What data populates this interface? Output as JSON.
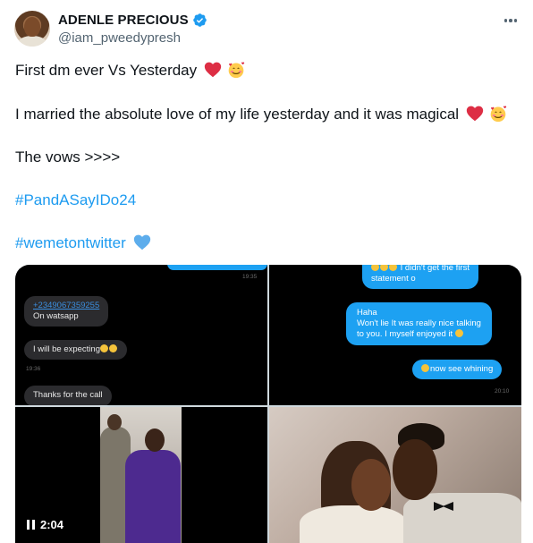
{
  "author": {
    "display_name": "ADENLE PRECIOUS",
    "handle": "@iam_pweedypresh",
    "verified": true
  },
  "tweet": {
    "line1": "First dm ever Vs Yesterday",
    "line2": "I married the absolute love of my life yesterday and it was magical",
    "line3": "The vows >>>>",
    "hashtag1": "#PandASayIDo24",
    "hashtag2": "#wemetontwitter"
  },
  "media": {
    "chat_left": {
      "top_time": "19:35",
      "phone": "+2349067359255",
      "on_watsapp": "On watsapp",
      "expecting": "I will be expecting",
      "mid_time": "19:36",
      "thanks": "Thanks for the call"
    },
    "chat_right": {
      "didnt_get": "I didn't get the first",
      "statement": "statement o",
      "haha": "Haha",
      "wont_lie": "Won't lie  It was really nice talking",
      "to_you": "to you. I myself enjoyed it",
      "whining": "now see whining",
      "time": "20:10"
    },
    "video_duration": "2:04"
  },
  "colors": {
    "link": "#1d9bf0",
    "verified_badge": "#1d9bf0",
    "heart": "#e0245e",
    "handle_grey": "#536471"
  }
}
